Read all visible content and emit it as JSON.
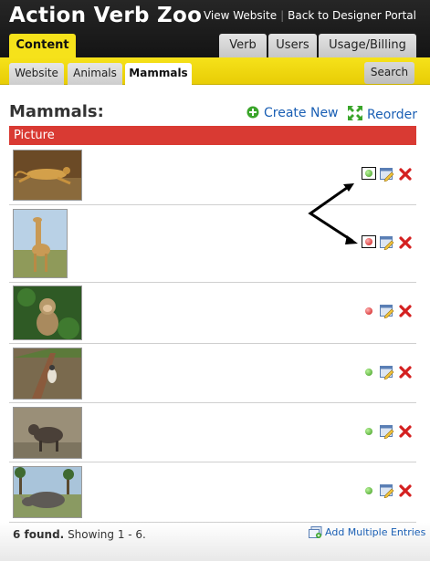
{
  "header": {
    "app_title": "Action Verb Zoo",
    "links": [
      "View Website",
      "Back to Designer Portal"
    ],
    "separator": "|"
  },
  "main_tabs": {
    "content": "Content",
    "verb": "Verb",
    "users": "Users",
    "usage": "Usage/Billing"
  },
  "sub_tabs": {
    "website": "Website",
    "animals": "Animals",
    "mammals": "Mammals",
    "search": "Search"
  },
  "section": {
    "title": "Mammals:",
    "create_new": "Create New",
    "reorder": "Reorder",
    "column_header": "Picture"
  },
  "rows": [
    {
      "animal": "cheetah",
      "status": "green",
      "highlighted": true
    },
    {
      "animal": "giraffe",
      "status": "red",
      "highlighted": true
    },
    {
      "animal": "monkey",
      "status": "red",
      "highlighted": false
    },
    {
      "animal": "badger",
      "status": "green",
      "highlighted": false
    },
    {
      "animal": "wild dog",
      "status": "green",
      "highlighted": false
    },
    {
      "animal": "rhinoceros",
      "status": "green",
      "highlighted": false
    }
  ],
  "footer": {
    "found_count": "6 found.",
    "showing": "Showing 1 - 6.",
    "add_multiple": "Add Multiple Entries"
  },
  "colors": {
    "header_bg": "#1c1c1c",
    "accent_yellow": "#f6e21a",
    "column_header_red": "#d93a33",
    "link_blue": "#1a5fb4",
    "delete_red": "#d42020",
    "status_green": "#3d9a1e",
    "status_red": "#cc1111"
  },
  "icons": {
    "create_new": "plus-circle-icon",
    "reorder": "expand-arrows-icon",
    "edit": "edit-pencil-icon",
    "delete": "delete-x-icon",
    "add_multiple": "add-multiple-icon"
  }
}
